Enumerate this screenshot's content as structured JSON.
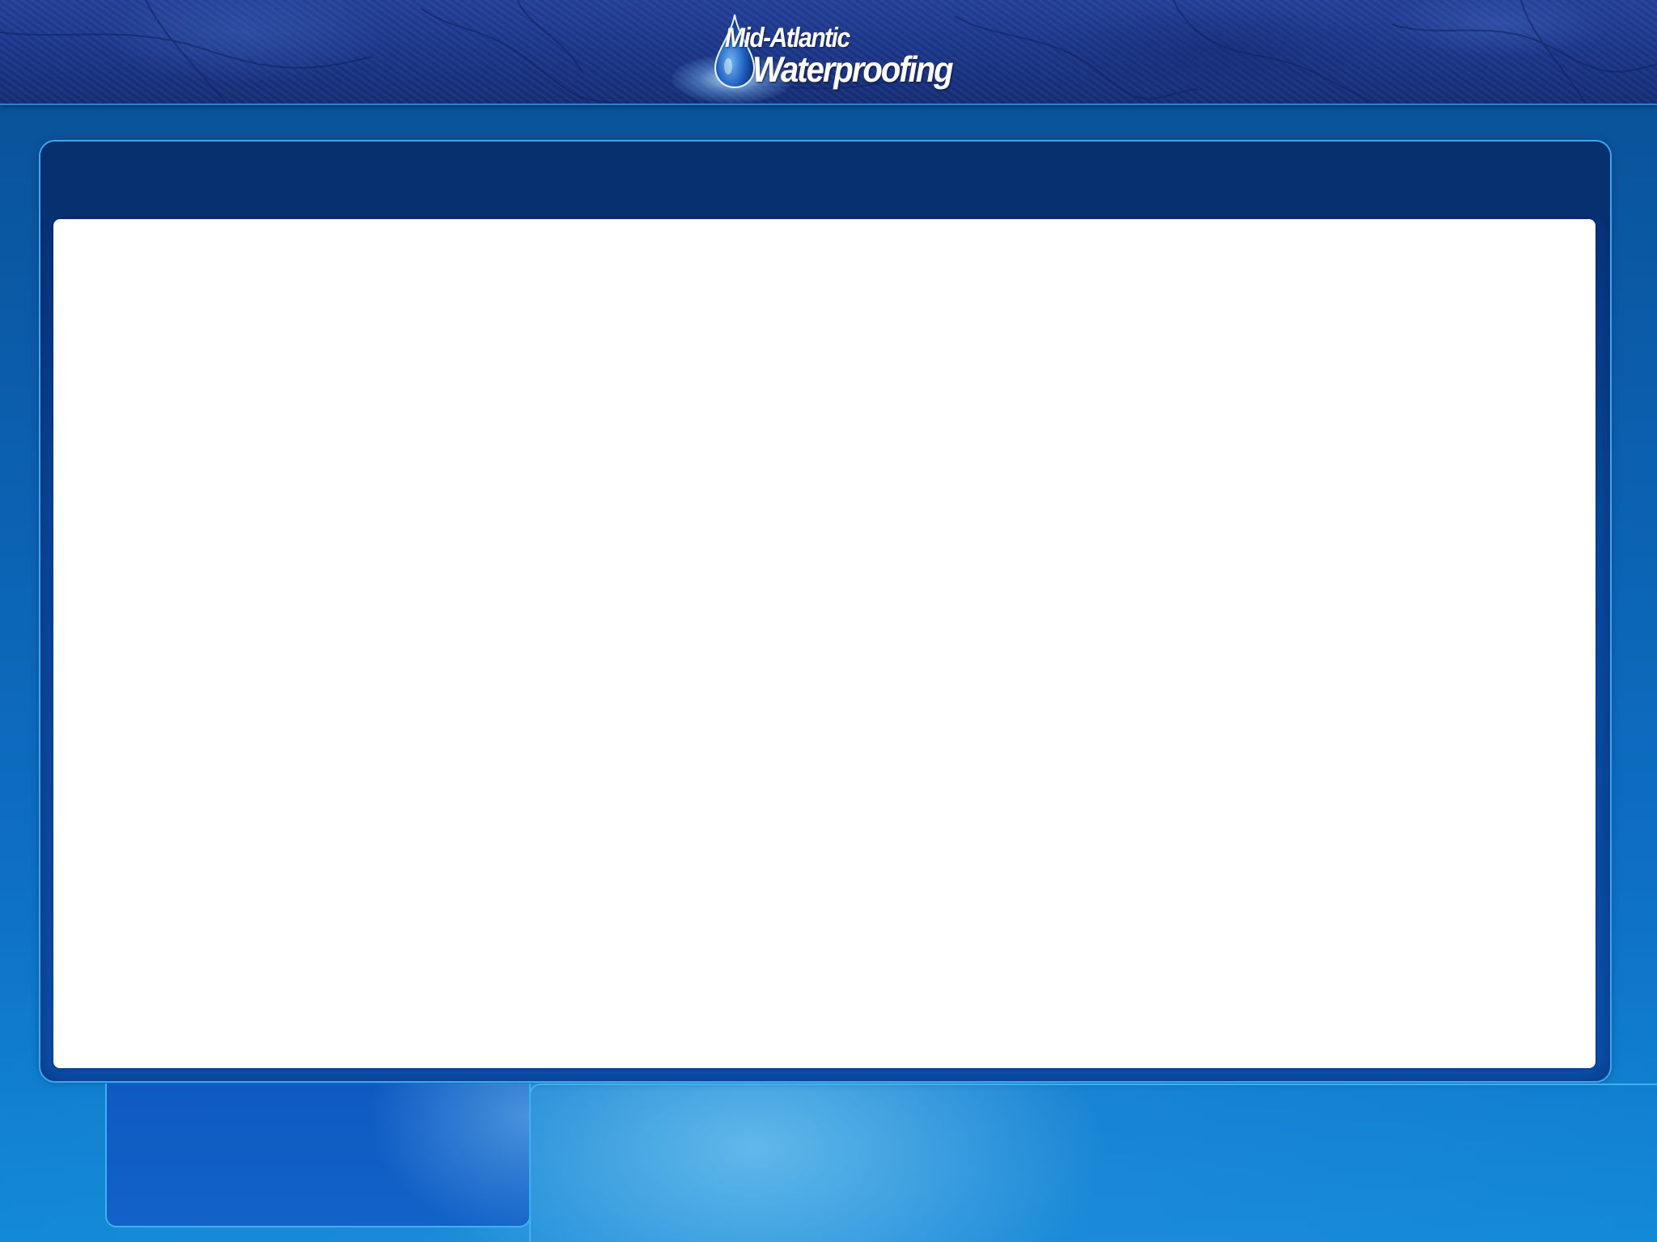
{
  "header": {
    "logo": {
      "line1": "Mid-Atlantic",
      "line2": "Waterproofing",
      "icon": "water-drop-icon"
    }
  },
  "colors": {
    "header_bg": "#1b3688",
    "page_bg": "#0b5fae",
    "frame_border": "#3fa6ee",
    "frame_header": "#06306f",
    "content_bg": "#ffffff"
  }
}
